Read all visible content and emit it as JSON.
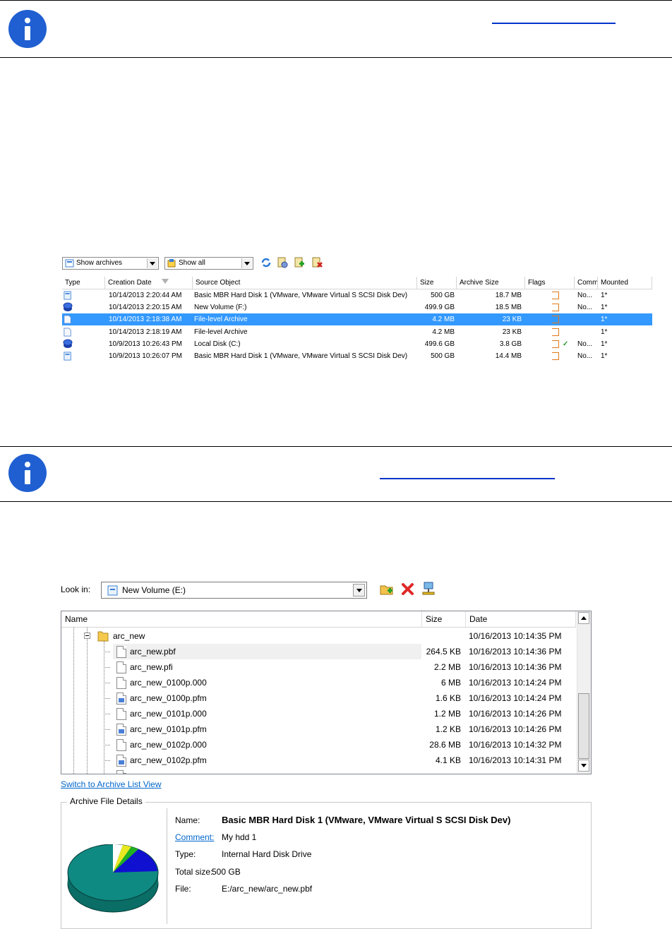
{
  "archive_list": {
    "combo_archives": "Show archives",
    "combo_show": "Show all",
    "toolbar_icons": [
      "refresh-icon",
      "properties-icon",
      "add-archive-icon",
      "delete-archive-icon"
    ],
    "columns": [
      "Type",
      "Creation Date",
      "Source Object",
      "Size",
      "Archive Size",
      "Flags",
      "Comm",
      "Mounted"
    ],
    "rows": [
      {
        "type_icon": "hard-disk-icon",
        "date": "10/14/2013 2:20:44 AM",
        "source": "Basic MBR Hard Disk 1 (VMware, VMware Virtual S SCSI Disk Dev)",
        "size": "500 GB",
        "archive_size": "18.7 MB",
        "comment": "No...",
        "mounted": "1*"
      },
      {
        "type_icon": "volume-icon",
        "date": "10/14/2013 2:20:15 AM",
        "source": "New Volume (F:)",
        "size": "499.9 GB",
        "archive_size": "18.5 MB",
        "comment": "No...",
        "mounted": "1*"
      },
      {
        "type_icon": "file-archive-icon",
        "date": "10/14/2013 2:18:38 AM",
        "source": "File-level Archive",
        "size": "4.2 MB",
        "archive_size": "23 KB",
        "comment": "",
        "mounted": "1*"
      },
      {
        "type_icon": "file-archive-icon",
        "date": "10/14/2013 2:18:19 AM",
        "source": "File-level Archive",
        "size": "4.2 MB",
        "archive_size": "23 KB",
        "comment": "",
        "mounted": "1*"
      },
      {
        "type_icon": "volume-icon",
        "date": "10/9/2013 10:26:43 PM",
        "source": "Local Disk (C:)",
        "size": "499.6 GB",
        "archive_size": "3.8 GB",
        "comment": "No...",
        "mounted": "1*"
      },
      {
        "type_icon": "hard-disk-icon",
        "date": "10/9/2013 10:26:07 PM",
        "source": "Basic MBR Hard Disk 1 (VMware, VMware Virtual S SCSI Disk Dev)",
        "size": "500 GB",
        "archive_size": "14.4 MB",
        "comment": "No...",
        "mounted": "1*"
      }
    ]
  },
  "file_browser": {
    "look_in_label": "Look in:",
    "look_in_value": "New Volume (E:)",
    "columns": {
      "name": "Name",
      "size": "Size",
      "date": "Date"
    },
    "folder": {
      "name": "arc_new",
      "date": "10/16/2013 10:14:35 PM"
    },
    "files": [
      {
        "name": "arc_new.pbf",
        "size": "264.5 KB",
        "date": "10/16/2013 10:14:36 PM",
        "kind": "file"
      },
      {
        "name": "arc_new.pfi",
        "size": "2.2 MB",
        "date": "10/16/2013 10:14:36 PM",
        "kind": "file"
      },
      {
        "name": "arc_new_0100p.000",
        "size": "6 MB",
        "date": "10/16/2013 10:14:24 PM",
        "kind": "file"
      },
      {
        "name": "arc_new_0100p.pfm",
        "size": "1.6 KB",
        "date": "10/16/2013 10:14:24 PM",
        "kind": "pfm"
      },
      {
        "name": "arc_new_0101p.000",
        "size": "1.2 MB",
        "date": "10/16/2013 10:14:26 PM",
        "kind": "file"
      },
      {
        "name": "arc_new_0101p.pfm",
        "size": "1.2 KB",
        "date": "10/16/2013 10:14:26 PM",
        "kind": "pfm"
      },
      {
        "name": "arc_new_0102p.000",
        "size": "28.6 MB",
        "date": "10/16/2013 10:14:32 PM",
        "kind": "file"
      },
      {
        "name": "arc_new_0102p.pfm",
        "size": "4.1 KB",
        "date": "10/16/2013 10:14:31 PM",
        "kind": "pfm"
      }
    ],
    "switch_link": "Switch to Archive List View",
    "details": {
      "legend": "Archive File Details",
      "name_label": "Name:",
      "name_value": "Basic MBR Hard Disk 1 (VMware, VMware Virtual S SCSI Disk Dev)",
      "comment_label": "Comment:",
      "comment_value": "My hdd 1",
      "type_label": "Type:",
      "type_value": "Internal Hard Disk Drive",
      "total_label": "Total size:",
      "total_value": "500 GB",
      "file_label": "File:",
      "file_value": "E:/arc_new/arc_new.pbf"
    }
  },
  "colors": {
    "accent_blue": "#3399ff",
    "info_icon": "#1f5fd1",
    "link": "#0033cc",
    "flag": "#e07a1a"
  }
}
